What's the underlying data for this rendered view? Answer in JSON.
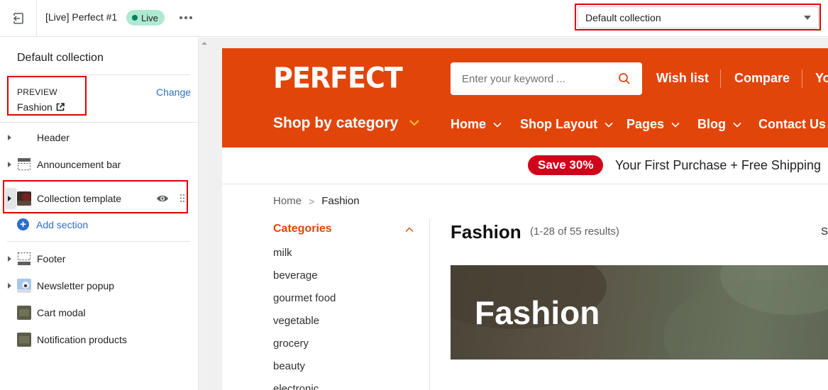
{
  "topbar": {
    "theme_name": "[Live] Perfect #1",
    "status_badge": "Live",
    "template_select_value": "Default collection"
  },
  "sidebar": {
    "title": "Default collection",
    "preview_label": "PREVIEW",
    "preview_value": "Fashion",
    "change_label": "Change",
    "sections": [
      {
        "label": "Header",
        "icon": "none"
      },
      {
        "label": "Announcement bar",
        "icon": "announcement-icon"
      },
      {
        "label": "Collection template",
        "icon": "thumbnail"
      },
      {
        "label": "Footer",
        "icon": "footer-icon"
      },
      {
        "label": "Newsletter popup",
        "icon": "thumbnail"
      },
      {
        "label": "Cart modal",
        "icon": "thumbnail"
      },
      {
        "label": "Notification products",
        "icon": "thumbnail"
      }
    ],
    "add_section_label": "Add section"
  },
  "store": {
    "logo": "PERFECT",
    "search_placeholder": "Enter your keyword ...",
    "top_links": [
      "Wish list",
      "Compare",
      "Yo"
    ],
    "shop_by_category": "Shop by category",
    "nav": [
      "Home",
      "Shop Layout",
      "Pages",
      "Blog",
      "Contact Us"
    ],
    "promo_badge": "Save 30%",
    "promo_text": "Your First Purchase + Free Shipping",
    "breadcrumb": {
      "home": "Home",
      "separator": ">",
      "current": "Fashion"
    },
    "categories_title": "Categories",
    "categories": [
      "milk",
      "beverage",
      "gourmet food",
      "vegetable",
      "grocery",
      "beauty",
      "electronic"
    ],
    "collection_title": "Fashion",
    "results_text": "(1-28 of 55 results)",
    "sort_partial": "S",
    "banner_title": "Fashion"
  },
  "colors": {
    "brand_orange": "#e1450a",
    "link_blue": "#2c6ecb",
    "live_green": "#aee9d1",
    "save_red": "#d0021b",
    "highlight_red": "#e00000"
  }
}
